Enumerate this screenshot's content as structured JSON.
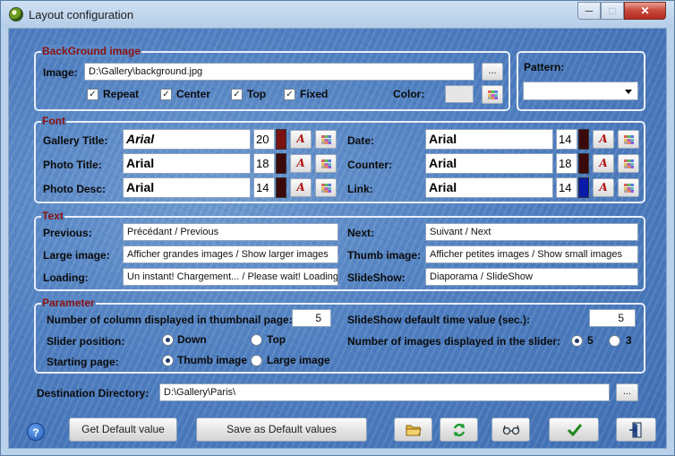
{
  "window": {
    "title": "Layout configuration"
  },
  "background": {
    "legend": "BackGround image",
    "image_label": "Image:",
    "image_value": "D:\\Gallery\\background.jpg",
    "browse_label": "...",
    "repeat_label": "Repeat",
    "center_label": "Center",
    "top_label": "Top",
    "fixed_label": "Fixed",
    "repeat_checked": true,
    "center_checked": true,
    "top_checked": true,
    "fixed_checked": true,
    "color_label": "Color:"
  },
  "pattern": {
    "label": "Pattern:",
    "value": ""
  },
  "font": {
    "legend": "Font",
    "rows": [
      {
        "label": "Gallery Title:",
        "font": "Arial",
        "size": "20",
        "color": "#7a1212",
        "italic": true
      },
      {
        "label": "Photo Title:",
        "font": "Arial",
        "size": "18",
        "color": "#3a0a0a"
      },
      {
        "label": "Photo Desc:",
        "font": "Arial",
        "size": "14",
        "color": "#3a0a0a"
      },
      {
        "label": "Date:",
        "font": "Arial",
        "size": "14",
        "color": "#3a0a0a"
      },
      {
        "label": "Counter:",
        "font": "Arial",
        "size": "18",
        "color": "#3a0a0a"
      },
      {
        "label": "Link:",
        "font": "Arial",
        "size": "14",
        "color": "#0a1aa8"
      }
    ],
    "a_button": "A"
  },
  "text": {
    "legend": "Text",
    "previous_label": "Previous:",
    "previous_value": "Précédant / Previous",
    "large_label": "Large image:",
    "large_value": "Afficher grandes images / Show larger images",
    "loading_label": "Loading:",
    "loading_value": "Un instant! Chargement... / Please wait! Loading...",
    "next_label": "Next:",
    "next_value": "Suivant / Next",
    "thumb_label": "Thumb image:",
    "thumb_value": "Afficher petites images / Show small images",
    "slideshow_label": "SlideShow:",
    "slideshow_value": "Diaporama / SlideShow"
  },
  "parameter": {
    "legend": "Parameter",
    "columns_label": "Number of column displayed in thumbnail page:",
    "columns_value": "5",
    "slider_pos_label": "Slider position:",
    "slider_down": "Down",
    "slider_top": "Top",
    "slider_selected": "Down",
    "starting_label": "Starting page:",
    "start_thumb": "Thumb image",
    "start_large": "Large image",
    "start_selected": "Thumb image",
    "slideshow_time_label": "SlideShow default time value (sec.):",
    "slideshow_time_value": "5",
    "images_slider_label": "Number of images displayed in the slider:",
    "images_opt_5": "5",
    "images_opt_3": "3",
    "images_selected": "5"
  },
  "destination": {
    "label": "Destination Directory:",
    "value": "D:\\Gallery\\Paris\\",
    "browse_label": "..."
  },
  "buttons": {
    "help": "?",
    "get_default": "Get Default value",
    "save_default": "Save as Default values"
  },
  "colors": {
    "legend": "#8b1010",
    "ok_check": "#1d8a1d",
    "refresh": "#1d9a2d"
  }
}
